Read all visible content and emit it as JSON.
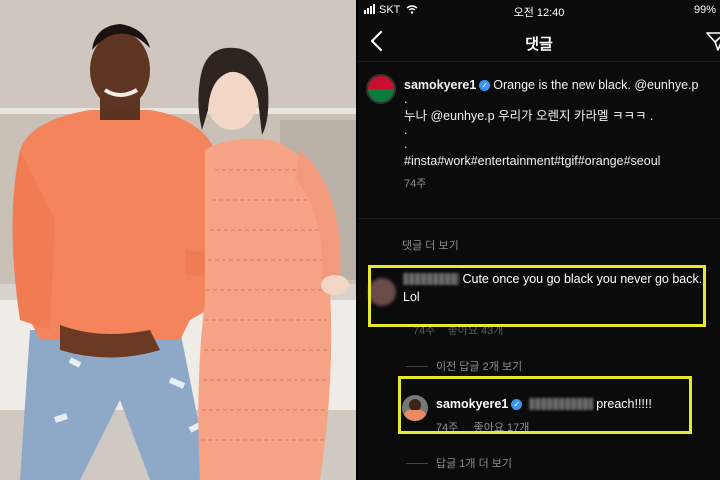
{
  "status_bar": {
    "carrier": "SKT",
    "time": "오전 12:40",
    "battery": "99%"
  },
  "nav": {
    "title": "댓글"
  },
  "post": {
    "username": "samokyere1",
    "caption_line1": "Orange is the new black. @eunhye.p",
    "caption_line2": "누나 @eunhye.p  우리가 오렌지 카라멜 ㅋㅋㅋ .",
    "hashtags": "#insta#work#entertainment#tgif#orange#seoul",
    "age": "74주"
  },
  "view_more_comments": "댓글 더 보기",
  "comment": {
    "text": "Cute once you go black you never go back. Lol",
    "age": "74주",
    "likes": "좋아요 43개"
  },
  "view_previous_replies": "이전 답글 2개 보기",
  "reply": {
    "username": "samokyere1",
    "text": "preach!!!!!",
    "age": "74주",
    "likes": "좋아요 17개"
  },
  "view_more_replies": "답글 1개 더 보기",
  "colors": {
    "highlight": "#e6ea2b",
    "verified": "#3897f0",
    "background": "#0b0b0b",
    "secondary_text": "#8e8e8e"
  }
}
